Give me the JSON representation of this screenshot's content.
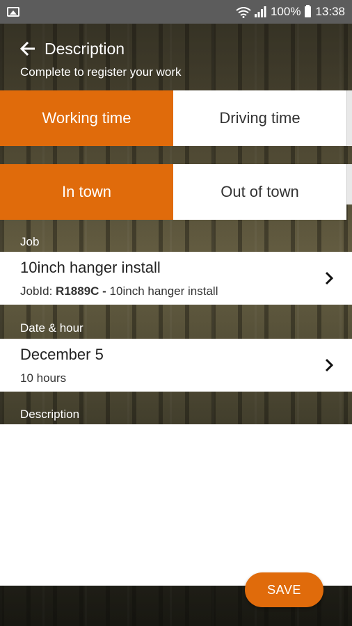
{
  "status_bar": {
    "battery_text": "100%",
    "time": "13:38",
    "icons": [
      "gallery-icon",
      "wifi-icon",
      "signal-icon",
      "battery-icon"
    ]
  },
  "header": {
    "title": "Description",
    "subtitle": "Complete to register your work",
    "back_icon": "arrow-left-icon"
  },
  "time_type": {
    "options": [
      "Working time",
      "Driving time"
    ],
    "selected": "Working time"
  },
  "location": {
    "options": [
      "In town",
      "Out of town"
    ],
    "selected": "In town"
  },
  "job": {
    "section_label": "Job",
    "title": "10inch hanger install",
    "jobid_label": "JobId:",
    "jobid_value": "R1889C -",
    "jobid_desc": "10inch hanger install"
  },
  "date_hour": {
    "section_label": "Date & hour",
    "date": "December 5",
    "hours": "10 hours"
  },
  "description": {
    "section_label": "Description",
    "value": ""
  },
  "actions": {
    "save_label": "SAVE"
  },
  "colors": {
    "accent": "#e06b0b",
    "status_bar": "#5c5c5c"
  }
}
